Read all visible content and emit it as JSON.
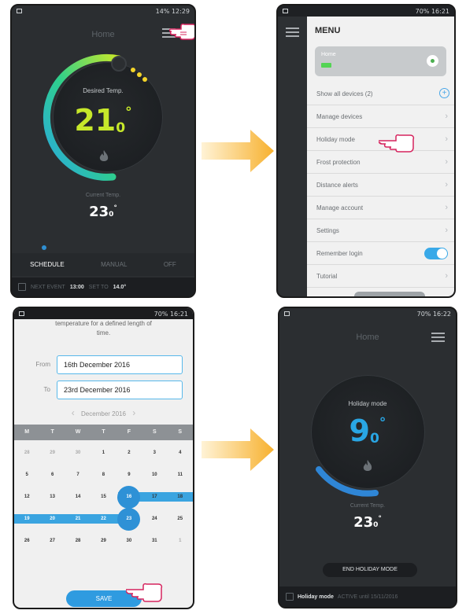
{
  "colors": {
    "accent_blue": "#2f9be0",
    "temp_green": "#c7e82a",
    "temp_blue": "#29a6e4",
    "arrow_orange": "#f7b12f",
    "hand_pink": "#d6245e",
    "dark_bg": "#2b2e31"
  },
  "screen1": {
    "status_time": "12:29",
    "status_battery": "14%",
    "title": "Home",
    "desired_label": "Desired Temp.",
    "desired_whole": "21",
    "desired_frac": "0",
    "desired_unit": "°",
    "current_label": "Current Temp.",
    "current_whole": "23",
    "current_frac": "0",
    "current_unit": "°",
    "modes": [
      "SCHEDULE",
      "MANUAL",
      "OFF"
    ],
    "next_event_label": "NEXT EVENT",
    "next_event_time": "13:00",
    "set_to_label": "SET TO",
    "set_to_value": "14.0°",
    "icons": [
      "menu-icon",
      "pointing-hand-icon",
      "flame-icon",
      "calendar-clock-icon"
    ]
  },
  "screen2": {
    "status_time": "16:21",
    "status_battery": "70%",
    "menu_title": "MENU",
    "home_device_name": "Home",
    "menu_items": [
      "Show all devices (2)",
      "Manage devices",
      "Holiday mode",
      "Frost protection",
      "Distance alerts",
      "Manage account",
      "Settings",
      "Remember login",
      "Tutorial"
    ],
    "remember_login_on": true
  },
  "screen3": {
    "status_time": "16:21",
    "status_battery": "70%",
    "intro_line1": "temperature for a defined length of",
    "intro_line2": "time.",
    "from_label": "From",
    "from_value": "16th December 2016",
    "to_label": "To",
    "to_value": "23rd December 2016",
    "month_label": "December 2016",
    "weekdays": [
      "M",
      "T",
      "W",
      "T",
      "F",
      "S",
      "S"
    ],
    "weeks": [
      [
        "28",
        "29",
        "30",
        "1",
        "2",
        "3",
        "4"
      ],
      [
        "5",
        "6",
        "7",
        "8",
        "9",
        "10",
        "11"
      ],
      [
        "12",
        "13",
        "14",
        "15",
        "16",
        "17",
        "18"
      ],
      [
        "19",
        "20",
        "21",
        "22",
        "23",
        "24",
        "25"
      ],
      [
        "26",
        "27",
        "28",
        "29",
        "30",
        "31",
        "1"
      ]
    ],
    "save_label": "SAVE"
  },
  "screen4": {
    "status_time": "16:22",
    "status_battery": "70%",
    "title": "Home",
    "mode_label": "Holiday mode",
    "temp_whole": "9",
    "temp_frac": "0",
    "temp_unit": "°",
    "current_label": "Current Temp.",
    "current_whole": "23",
    "current_frac": "0",
    "current_unit": "°",
    "end_button": "END HOLIDAY MODE",
    "footer_mode": "Holiday mode",
    "footer_status": "ACTIVE until 15/11/2016"
  }
}
